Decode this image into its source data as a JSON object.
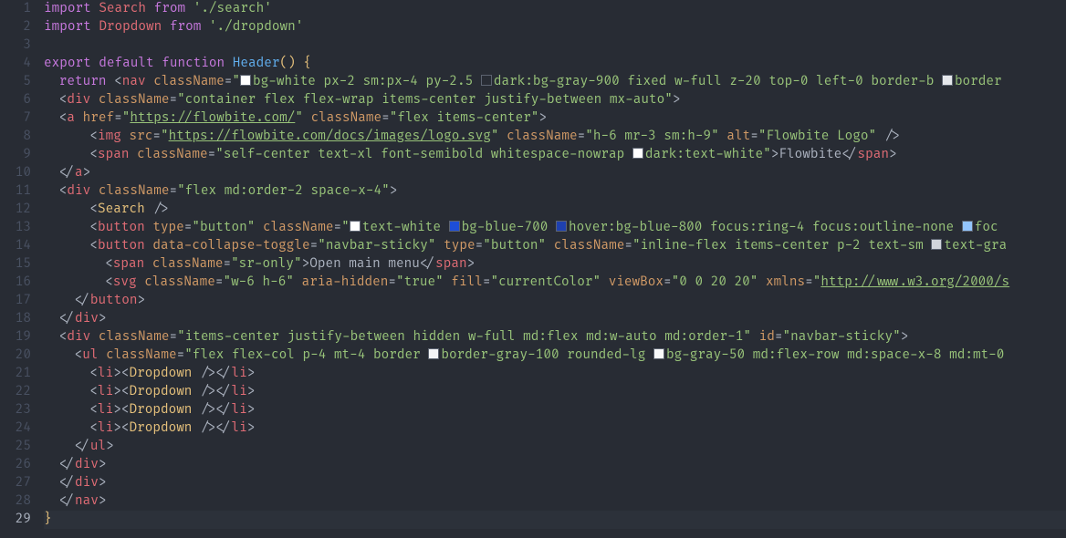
{
  "lines": [
    {
      "n": 1,
      "indent": 0,
      "tokens": [
        {
          "t": "import ",
          "c": "kw"
        },
        {
          "t": "Search ",
          "c": "id"
        },
        {
          "t": "from ",
          "c": "kw"
        },
        {
          "t": "'./search'",
          "c": "str"
        }
      ]
    },
    {
      "n": 2,
      "indent": 0,
      "tokens": [
        {
          "t": "import ",
          "c": "kw"
        },
        {
          "t": "Dropdown ",
          "c": "id"
        },
        {
          "t": "from ",
          "c": "kw"
        },
        {
          "t": "'./dropdown'",
          "c": "str"
        }
      ]
    },
    {
      "n": 3,
      "indent": 0,
      "tokens": []
    },
    {
      "n": 4,
      "indent": 0,
      "tokens": [
        {
          "t": "export default ",
          "c": "kw"
        },
        {
          "t": "function ",
          "c": "kw"
        },
        {
          "t": "Header",
          "c": "fn"
        },
        {
          "t": "()",
          "c": "brkY"
        },
        {
          "t": " ",
          "c": "pun"
        },
        {
          "t": "{",
          "c": "brkY"
        }
      ]
    },
    {
      "n": 5,
      "indent": 1,
      "tokens": [
        {
          "t": "return ",
          "c": "kw"
        },
        {
          "t": "<",
          "c": "pun"
        },
        {
          "t": "nav ",
          "c": "id"
        },
        {
          "t": "className",
          "c": "attr"
        },
        {
          "t": "=",
          "c": "pun"
        },
        {
          "t": "\"",
          "c": "str"
        },
        {
          "sw": "#ffffff"
        },
        {
          "t": "bg-white px-2 sm:px-4 py-2.5 ",
          "c": "str"
        },
        {
          "sw": "transparent"
        },
        {
          "t": "dark:bg-gray-900 fixed w-full z-20 top-0 left-0 border-b ",
          "c": "str"
        },
        {
          "sw": "#e5e7eb"
        },
        {
          "t": "border",
          "c": "str"
        }
      ]
    },
    {
      "n": 6,
      "indent": 1,
      "tokens": [
        {
          "t": "<",
          "c": "pun"
        },
        {
          "t": "div ",
          "c": "id"
        },
        {
          "t": "className",
          "c": "attr"
        },
        {
          "t": "=",
          "c": "pun"
        },
        {
          "t": "\"container flex flex-wrap items-center justify-between mx-auto\"",
          "c": "str"
        },
        {
          "t": ">",
          "c": "pun"
        }
      ]
    },
    {
      "n": 7,
      "indent": 1,
      "tokens": [
        {
          "t": "<",
          "c": "pun"
        },
        {
          "t": "a ",
          "c": "id"
        },
        {
          "t": "href",
          "c": "attr"
        },
        {
          "t": "=",
          "c": "pun"
        },
        {
          "t": "\"",
          "c": "str"
        },
        {
          "t": "https://flowbite.com/",
          "c": "str ul"
        },
        {
          "t": "\"",
          "c": "str"
        },
        {
          "t": " ",
          "c": "pun"
        },
        {
          "t": "className",
          "c": "attr"
        },
        {
          "t": "=",
          "c": "pun"
        },
        {
          "t": "\"flex items-center\"",
          "c": "str"
        },
        {
          "t": ">",
          "c": "pun"
        }
      ]
    },
    {
      "n": 8,
      "indent": 3,
      "tokens": [
        {
          "t": "<",
          "c": "pun"
        },
        {
          "t": "img ",
          "c": "id"
        },
        {
          "t": "src",
          "c": "attr"
        },
        {
          "t": "=",
          "c": "pun"
        },
        {
          "t": "\"",
          "c": "str"
        },
        {
          "t": "https://flowbite.com/docs/images/logo.svg",
          "c": "str ul"
        },
        {
          "t": "\"",
          "c": "str"
        },
        {
          "t": " ",
          "c": "pun"
        },
        {
          "t": "className",
          "c": "attr"
        },
        {
          "t": "=",
          "c": "pun"
        },
        {
          "t": "\"h-6 mr-3 sm:h-9\"",
          "c": "str"
        },
        {
          "t": " ",
          "c": "pun"
        },
        {
          "t": "alt",
          "c": "attr"
        },
        {
          "t": "=",
          "c": "pun"
        },
        {
          "t": "\"Flowbite Logo\"",
          "c": "str"
        },
        {
          "t": " />",
          "c": "pun"
        }
      ]
    },
    {
      "n": 9,
      "indent": 3,
      "tokens": [
        {
          "t": "<",
          "c": "pun"
        },
        {
          "t": "span ",
          "c": "id"
        },
        {
          "t": "className",
          "c": "attr"
        },
        {
          "t": "=",
          "c": "pun"
        },
        {
          "t": "\"self-center text-xl font-semibold whitespace-nowrap ",
          "c": "str"
        },
        {
          "sw": "#ffffff"
        },
        {
          "t": "dark:text-white\"",
          "c": "str"
        },
        {
          "t": ">",
          "c": "pun"
        },
        {
          "t": "Flowbite",
          "c": "pun"
        },
        {
          "t": "</",
          "c": "pun"
        },
        {
          "t": "span",
          "c": "id"
        },
        {
          "t": ">",
          "c": "pun"
        }
      ]
    },
    {
      "n": 10,
      "indent": 1,
      "tokens": [
        {
          "t": "</",
          "c": "pun"
        },
        {
          "t": "a",
          "c": "id"
        },
        {
          "t": ">",
          "c": "pun"
        }
      ]
    },
    {
      "n": 11,
      "indent": 1,
      "tokens": [
        {
          "t": "<",
          "c": "pun"
        },
        {
          "t": "div ",
          "c": "id"
        },
        {
          "t": "className",
          "c": "attr"
        },
        {
          "t": "=",
          "c": "pun"
        },
        {
          "t": "\"flex md:order-2 space-x-4\"",
          "c": "str"
        },
        {
          "t": ">",
          "c": "pun"
        }
      ]
    },
    {
      "n": 12,
      "indent": 3,
      "tokens": [
        {
          "t": "<",
          "c": "pun"
        },
        {
          "t": "Search ",
          "c": "cls"
        },
        {
          "t": "/>",
          "c": "pun"
        }
      ]
    },
    {
      "n": 13,
      "indent": 3,
      "tokens": [
        {
          "t": "<",
          "c": "pun"
        },
        {
          "t": "button ",
          "c": "id"
        },
        {
          "t": "type",
          "c": "attr"
        },
        {
          "t": "=",
          "c": "pun"
        },
        {
          "t": "\"button\"",
          "c": "str"
        },
        {
          "t": " ",
          "c": "pun"
        },
        {
          "t": "className",
          "c": "attr"
        },
        {
          "t": "=",
          "c": "pun"
        },
        {
          "t": "\"",
          "c": "str"
        },
        {
          "sw": "#ffffff"
        },
        {
          "t": "text-white ",
          "c": "str"
        },
        {
          "sw": "#1d4ed8"
        },
        {
          "t": "bg-blue-700 ",
          "c": "str"
        },
        {
          "sw": "#1e40af"
        },
        {
          "t": "hover:bg-blue-800 focus:ring-4 focus:outline-none ",
          "c": "str"
        },
        {
          "sw": "#93c5fd"
        },
        {
          "t": "foc",
          "c": "str"
        }
      ]
    },
    {
      "n": 14,
      "indent": 3,
      "tokens": [
        {
          "t": "<",
          "c": "pun"
        },
        {
          "t": "button ",
          "c": "id"
        },
        {
          "t": "data-collapse-toggle",
          "c": "attr"
        },
        {
          "t": "=",
          "c": "pun"
        },
        {
          "t": "\"navbar-sticky\"",
          "c": "str"
        },
        {
          "t": " ",
          "c": "pun"
        },
        {
          "t": "type",
          "c": "attr"
        },
        {
          "t": "=",
          "c": "pun"
        },
        {
          "t": "\"button\"",
          "c": "str"
        },
        {
          "t": " ",
          "c": "pun"
        },
        {
          "t": "className",
          "c": "attr"
        },
        {
          "t": "=",
          "c": "pun"
        },
        {
          "t": "\"inline-flex items-center p-2 text-sm ",
          "c": "str"
        },
        {
          "sw": "#d1d5db"
        },
        {
          "t": "text-gra",
          "c": "str"
        }
      ]
    },
    {
      "n": 15,
      "indent": 4,
      "tokens": [
        {
          "t": "<",
          "c": "pun"
        },
        {
          "t": "span ",
          "c": "id"
        },
        {
          "t": "className",
          "c": "attr"
        },
        {
          "t": "=",
          "c": "pun"
        },
        {
          "t": "\"sr-only\"",
          "c": "str"
        },
        {
          "t": ">",
          "c": "pun"
        },
        {
          "t": "Open main menu",
          "c": "pun"
        },
        {
          "t": "</",
          "c": "pun"
        },
        {
          "t": "span",
          "c": "id"
        },
        {
          "t": ">",
          "c": "pun"
        }
      ]
    },
    {
      "n": 16,
      "indent": 4,
      "tokens": [
        {
          "t": "<",
          "c": "pun"
        },
        {
          "t": "svg ",
          "c": "id"
        },
        {
          "t": "className",
          "c": "attr"
        },
        {
          "t": "=",
          "c": "pun"
        },
        {
          "t": "\"w-6 h-6\"",
          "c": "str"
        },
        {
          "t": " ",
          "c": "pun"
        },
        {
          "t": "aria-hidden",
          "c": "attr"
        },
        {
          "t": "=",
          "c": "pun"
        },
        {
          "t": "\"true\"",
          "c": "str"
        },
        {
          "t": " ",
          "c": "pun"
        },
        {
          "t": "fill",
          "c": "attr"
        },
        {
          "t": "=",
          "c": "pun"
        },
        {
          "t": "\"currentColor\"",
          "c": "str"
        },
        {
          "t": " ",
          "c": "pun"
        },
        {
          "t": "viewBox",
          "c": "attr"
        },
        {
          "t": "=",
          "c": "pun"
        },
        {
          "t": "\"0 0 20 20\"",
          "c": "str"
        },
        {
          "t": " ",
          "c": "pun"
        },
        {
          "t": "xmlns",
          "c": "attr"
        },
        {
          "t": "=",
          "c": "pun"
        },
        {
          "t": "\"",
          "c": "str"
        },
        {
          "t": "http://www.w3.org/2000/s",
          "c": "str ul"
        }
      ]
    },
    {
      "n": 17,
      "indent": 2,
      "tokens": [
        {
          "t": "</",
          "c": "pun"
        },
        {
          "t": "button",
          "c": "id"
        },
        {
          "t": ">",
          "c": "pun"
        }
      ]
    },
    {
      "n": 18,
      "indent": 1,
      "tokens": [
        {
          "t": "</",
          "c": "pun"
        },
        {
          "t": "div",
          "c": "id"
        },
        {
          "t": ">",
          "c": "pun"
        }
      ]
    },
    {
      "n": 19,
      "indent": 1,
      "tokens": [
        {
          "t": "<",
          "c": "pun"
        },
        {
          "t": "div ",
          "c": "id"
        },
        {
          "t": "className",
          "c": "attr"
        },
        {
          "t": "=",
          "c": "pun"
        },
        {
          "t": "\"items-center justify-between hidden w-full md:flex md:w-auto md:order-1\"",
          "c": "str"
        },
        {
          "t": " ",
          "c": "pun"
        },
        {
          "t": "id",
          "c": "attr"
        },
        {
          "t": "=",
          "c": "pun"
        },
        {
          "t": "\"navbar-sticky\"",
          "c": "str"
        },
        {
          "t": ">",
          "c": "pun"
        }
      ]
    },
    {
      "n": 20,
      "indent": 2,
      "tokens": [
        {
          "t": "<",
          "c": "pun"
        },
        {
          "t": "ul ",
          "c": "id"
        },
        {
          "t": "className",
          "c": "attr"
        },
        {
          "t": "=",
          "c": "pun"
        },
        {
          "t": "\"flex flex-col p-4 mt-4 border ",
          "c": "str"
        },
        {
          "sw": "#f3f4f6"
        },
        {
          "t": "border-gray-100 rounded-lg ",
          "c": "str"
        },
        {
          "sw": "#f9fafb"
        },
        {
          "t": "bg-gray-50 md:flex-row md:space-x-8 md:mt-0",
          "c": "str"
        }
      ]
    },
    {
      "n": 21,
      "indent": 3,
      "tokens": [
        {
          "t": "<",
          "c": "pun"
        },
        {
          "t": "li",
          "c": "id"
        },
        {
          "t": ">",
          "c": "pun"
        },
        {
          "t": "<",
          "c": "pun"
        },
        {
          "t": "Dropdown ",
          "c": "cls"
        },
        {
          "t": "/>",
          "c": "pun"
        },
        {
          "t": "</",
          "c": "pun"
        },
        {
          "t": "li",
          "c": "id"
        },
        {
          "t": ">",
          "c": "pun"
        }
      ]
    },
    {
      "n": 22,
      "indent": 3,
      "tokens": [
        {
          "t": "<",
          "c": "pun"
        },
        {
          "t": "li",
          "c": "id"
        },
        {
          "t": ">",
          "c": "pun"
        },
        {
          "t": "<",
          "c": "pun"
        },
        {
          "t": "Dropdown ",
          "c": "cls"
        },
        {
          "t": "/>",
          "c": "pun"
        },
        {
          "t": "</",
          "c": "pun"
        },
        {
          "t": "li",
          "c": "id"
        },
        {
          "t": ">",
          "c": "pun"
        }
      ]
    },
    {
      "n": 23,
      "indent": 3,
      "tokens": [
        {
          "t": "<",
          "c": "pun"
        },
        {
          "t": "li",
          "c": "id"
        },
        {
          "t": ">",
          "c": "pun"
        },
        {
          "t": "<",
          "c": "pun"
        },
        {
          "t": "Dropdown ",
          "c": "cls"
        },
        {
          "t": "/>",
          "c": "pun"
        },
        {
          "t": "</",
          "c": "pun"
        },
        {
          "t": "li",
          "c": "id"
        },
        {
          "t": ">",
          "c": "pun"
        }
      ]
    },
    {
      "n": 24,
      "indent": 3,
      "tokens": [
        {
          "t": "<",
          "c": "pun"
        },
        {
          "t": "li",
          "c": "id"
        },
        {
          "t": ">",
          "c": "pun"
        },
        {
          "t": "<",
          "c": "pun"
        },
        {
          "t": "Dropdown ",
          "c": "cls"
        },
        {
          "t": "/>",
          "c": "pun"
        },
        {
          "t": "</",
          "c": "pun"
        },
        {
          "t": "li",
          "c": "id"
        },
        {
          "t": ">",
          "c": "pun"
        }
      ]
    },
    {
      "n": 25,
      "indent": 2,
      "tokens": [
        {
          "t": "</",
          "c": "pun"
        },
        {
          "t": "ul",
          "c": "id"
        },
        {
          "t": ">",
          "c": "pun"
        }
      ]
    },
    {
      "n": 26,
      "indent": 1,
      "tokens": [
        {
          "t": "</",
          "c": "pun"
        },
        {
          "t": "div",
          "c": "id"
        },
        {
          "t": ">",
          "c": "pun"
        }
      ]
    },
    {
      "n": 27,
      "indent": 1,
      "tokens": [
        {
          "t": "</",
          "c": "pun"
        },
        {
          "t": "div",
          "c": "id"
        },
        {
          "t": ">",
          "c": "pun"
        }
      ]
    },
    {
      "n": 28,
      "indent": 1,
      "tokens": [
        {
          "t": "</",
          "c": "pun"
        },
        {
          "t": "nav",
          "c": "id"
        },
        {
          "t": ">",
          "c": "pun"
        }
      ]
    },
    {
      "n": 29,
      "indent": 0,
      "active": true,
      "tokens": [
        {
          "t": "}",
          "c": "brkY"
        }
      ]
    }
  ]
}
